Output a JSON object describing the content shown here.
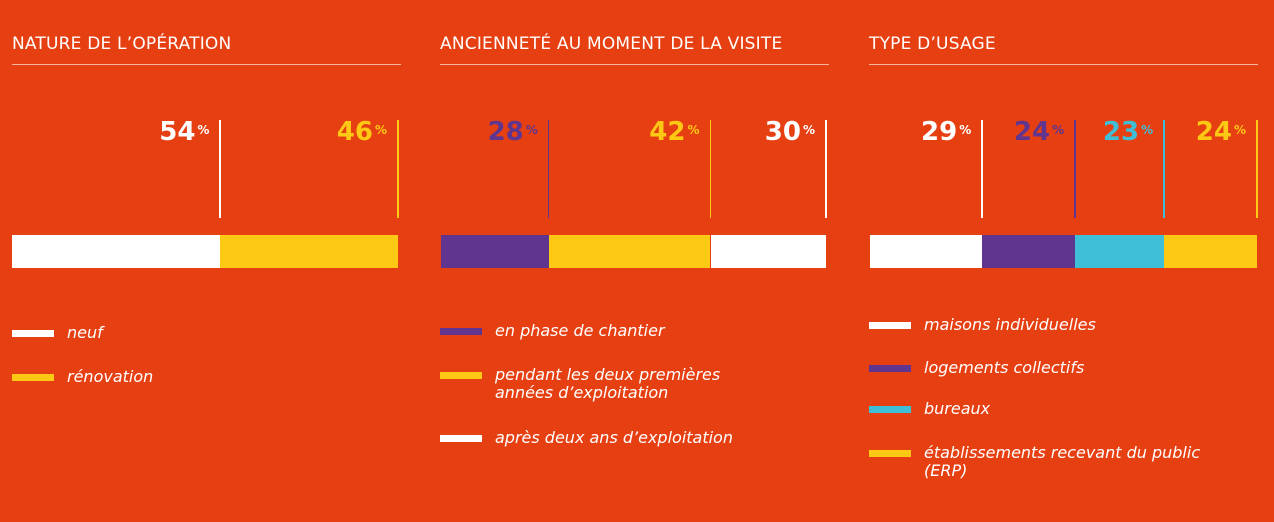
{
  "colors": {
    "background": "#e64012",
    "white": "#ffffff",
    "yellow": "#fdc914",
    "purple": "#5f3590",
    "cyan": "#3fbed8"
  },
  "chart_data": [
    {
      "type": "bar",
      "title": "NATURE DE L’OPÉRATION",
      "unit": "%",
      "stacked": true,
      "orientation": "horizontal",
      "series": [
        {
          "name": "neuf",
          "value": 54,
          "label": "54",
          "color": "#ffffff"
        },
        {
          "name": "rénovation",
          "value": 46,
          "label": "46",
          "color": "#fdc914"
        }
      ]
    },
    {
      "type": "bar",
      "title": "ANCIENNETÉ AU MOMENT DE LA VISITE",
      "unit": "%",
      "stacked": true,
      "orientation": "horizontal",
      "series": [
        {
          "name": "en phase de chantier",
          "value": 28,
          "label": "28",
          "color": "#5f3590"
        },
        {
          "name": "pendant les deux premières années d’exploitation",
          "value": 42,
          "label": "42",
          "color": "#fdc914"
        },
        {
          "name": "après deux ans d’exploitation",
          "value": 30,
          "label": "30",
          "color": "#ffffff"
        }
      ]
    },
    {
      "type": "bar",
      "title": "TYPE D’USAGE",
      "unit": "%",
      "stacked": true,
      "orientation": "horizontal",
      "series": [
        {
          "name": "maisons individuelles",
          "value": 29,
          "label": "29",
          "color": "#ffffff"
        },
        {
          "name": "logements collectifs",
          "value": 24,
          "label": "24",
          "color": "#5f3590"
        },
        {
          "name": "bureaux",
          "value": 23,
          "label": "23",
          "color": "#3fbed8"
        },
        {
          "name": "établissements recevant du public (ERP)",
          "value": 24,
          "label": "24",
          "color": "#fdc914"
        }
      ]
    }
  ]
}
